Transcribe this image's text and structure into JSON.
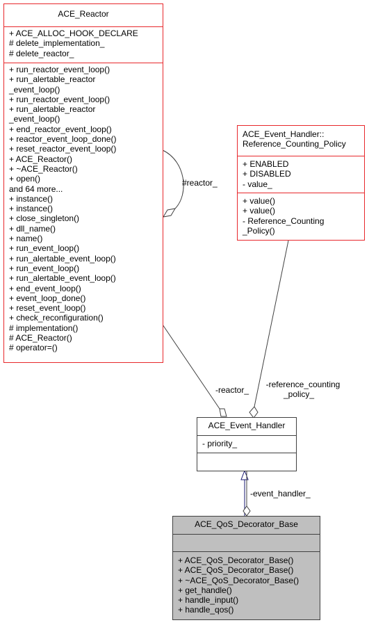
{
  "classes": {
    "reactor": {
      "name": "ACE_Reactor",
      "attributes": [
        "+ ACE_ALLOC_HOOK_DECLARE",
        "# delete_implementation_",
        "# delete_reactor_"
      ],
      "methods": [
        "+ run_reactor_event_loop()",
        "+ run_alertable_reactor",
        "_event_loop()",
        "+ run_reactor_event_loop()",
        "+ run_alertable_reactor",
        "_event_loop()",
        "+ end_reactor_event_loop()",
        "+ reactor_event_loop_done()",
        "+ reset_reactor_event_loop()",
        "+ ACE_Reactor()",
        "+ ~ACE_Reactor()",
        "+ open()",
        "and 64 more...",
        "+ instance()",
        "+ instance()",
        "+ close_singleton()",
        "+ dll_name()",
        "+ name()",
        "+ run_event_loop()",
        "+ run_alertable_event_loop()",
        "+ run_event_loop()",
        "+ run_alertable_event_loop()",
        "+ end_event_loop()",
        "+ event_loop_done()",
        "+ reset_event_loop()",
        "+ check_reconfiguration()",
        "# implementation()",
        "# ACE_Reactor()",
        "# operator=()"
      ]
    },
    "policy": {
      "name_lines": [
        "ACE_Event_Handler::",
        "Reference_Counting_Policy"
      ],
      "attributes": [
        "+ ENABLED",
        "+ DISABLED",
        "- value_"
      ],
      "methods": [
        "+ value()",
        "+ value()",
        "- Reference_Counting",
        "_Policy()"
      ]
    },
    "event_handler": {
      "name": "ACE_Event_Handler",
      "attributes": [
        "- priority_"
      ],
      "methods": []
    },
    "qos_base": {
      "name": "ACE_QoS_Decorator_Base",
      "attributes": [],
      "methods": [
        "+ ACE_QoS_Decorator_Base()",
        "+ ACE_QoS_Decorator_Base()",
        "+ ~ACE_QoS_Decorator_Base()",
        "+ get_handle()",
        "+ handle_input()",
        "+ handle_qos()"
      ]
    }
  },
  "edges": {
    "self_reactor": "#reactor_",
    "reactor": "-reactor_",
    "policy_lines": [
      "-reference_counting",
      "_policy_"
    ],
    "event_handler": "-event_handler_"
  },
  "colors": {
    "class_border": "#e8272b",
    "focus_fill": "#bfbfbf",
    "edge": "#404040",
    "inherit": "#191970"
  }
}
